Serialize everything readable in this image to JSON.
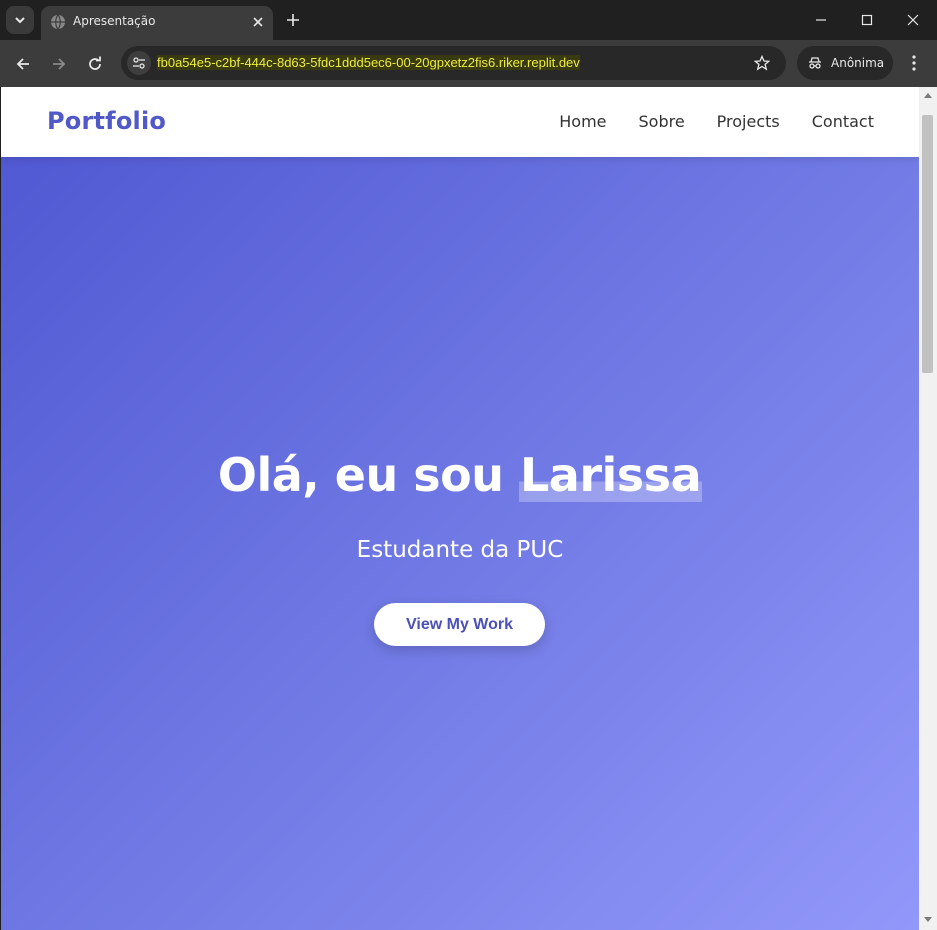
{
  "browser": {
    "tab_title": "Apresentação",
    "url": "fb0a54e5-c2bf-444c-8d63-5fdc1ddd5ec6-00-20gpxetz2fis6.riker.replit.dev",
    "profile_label": "Anônima"
  },
  "site": {
    "logo": "Portfolio",
    "nav": [
      "Home",
      "Sobre",
      "Projects",
      "Contact"
    ]
  },
  "hero": {
    "title_prefix": "Olá, eu sou ",
    "title_name": "Larissa",
    "subtitle": "Estudante da PUC",
    "cta_label": "View My Work"
  },
  "colors": {
    "brand": "#5159c8",
    "gradient_start": "#5159d3",
    "gradient_end": "#9298fa"
  }
}
